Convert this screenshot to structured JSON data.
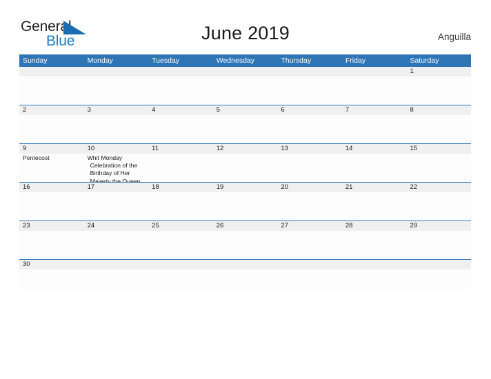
{
  "brand": {
    "word_general": "General",
    "word_blue": "Blue",
    "flag_icon": "blue-triangle-flag-icon",
    "accent_blue": "#1b7cc4"
  },
  "header": {
    "title": "June 2019",
    "locale": "Anguilla"
  },
  "theme": {
    "header_blue": "#2e75b6",
    "row_separator": "#2e75b6",
    "date_band": "#f0f0f0",
    "page_background": "#ffffff",
    "text": "#1a1a1a"
  },
  "calendar": {
    "weekdays": [
      "Sunday",
      "Monday",
      "Tuesday",
      "Wednesday",
      "Thursday",
      "Friday",
      "Saturday"
    ],
    "weeks": [
      {
        "days": [
          {
            "date": "",
            "events": []
          },
          {
            "date": "",
            "events": []
          },
          {
            "date": "",
            "events": []
          },
          {
            "date": "",
            "events": []
          },
          {
            "date": "",
            "events": []
          },
          {
            "date": "",
            "events": []
          },
          {
            "date": "1",
            "events": []
          }
        ]
      },
      {
        "days": [
          {
            "date": "2",
            "events": []
          },
          {
            "date": "3",
            "events": []
          },
          {
            "date": "4",
            "events": []
          },
          {
            "date": "5",
            "events": []
          },
          {
            "date": "6",
            "events": []
          },
          {
            "date": "7",
            "events": []
          },
          {
            "date": "8",
            "events": []
          }
        ]
      },
      {
        "days": [
          {
            "date": "9",
            "events": [
              "Pentecost"
            ]
          },
          {
            "date": "10",
            "events": [
              "Whit Monday",
              "Celebration of the Birthday of Her Majesty the Queen"
            ]
          },
          {
            "date": "11",
            "events": []
          },
          {
            "date": "12",
            "events": []
          },
          {
            "date": "13",
            "events": []
          },
          {
            "date": "14",
            "events": []
          },
          {
            "date": "15",
            "events": []
          }
        ]
      },
      {
        "days": [
          {
            "date": "16",
            "events": []
          },
          {
            "date": "17",
            "events": []
          },
          {
            "date": "18",
            "events": []
          },
          {
            "date": "19",
            "events": []
          },
          {
            "date": "20",
            "events": []
          },
          {
            "date": "21",
            "events": []
          },
          {
            "date": "22",
            "events": []
          }
        ]
      },
      {
        "days": [
          {
            "date": "23",
            "events": []
          },
          {
            "date": "24",
            "events": []
          },
          {
            "date": "25",
            "events": []
          },
          {
            "date": "26",
            "events": []
          },
          {
            "date": "27",
            "events": []
          },
          {
            "date": "28",
            "events": []
          },
          {
            "date": "29",
            "events": []
          }
        ]
      },
      {
        "days": [
          {
            "date": "30",
            "events": []
          },
          {
            "date": "",
            "events": []
          },
          {
            "date": "",
            "events": []
          },
          {
            "date": "",
            "events": []
          },
          {
            "date": "",
            "events": []
          },
          {
            "date": "",
            "events": []
          },
          {
            "date": "",
            "events": []
          }
        ]
      }
    ],
    "week_heights": [
      55,
      55,
      55,
      55,
      55,
      45
    ]
  }
}
